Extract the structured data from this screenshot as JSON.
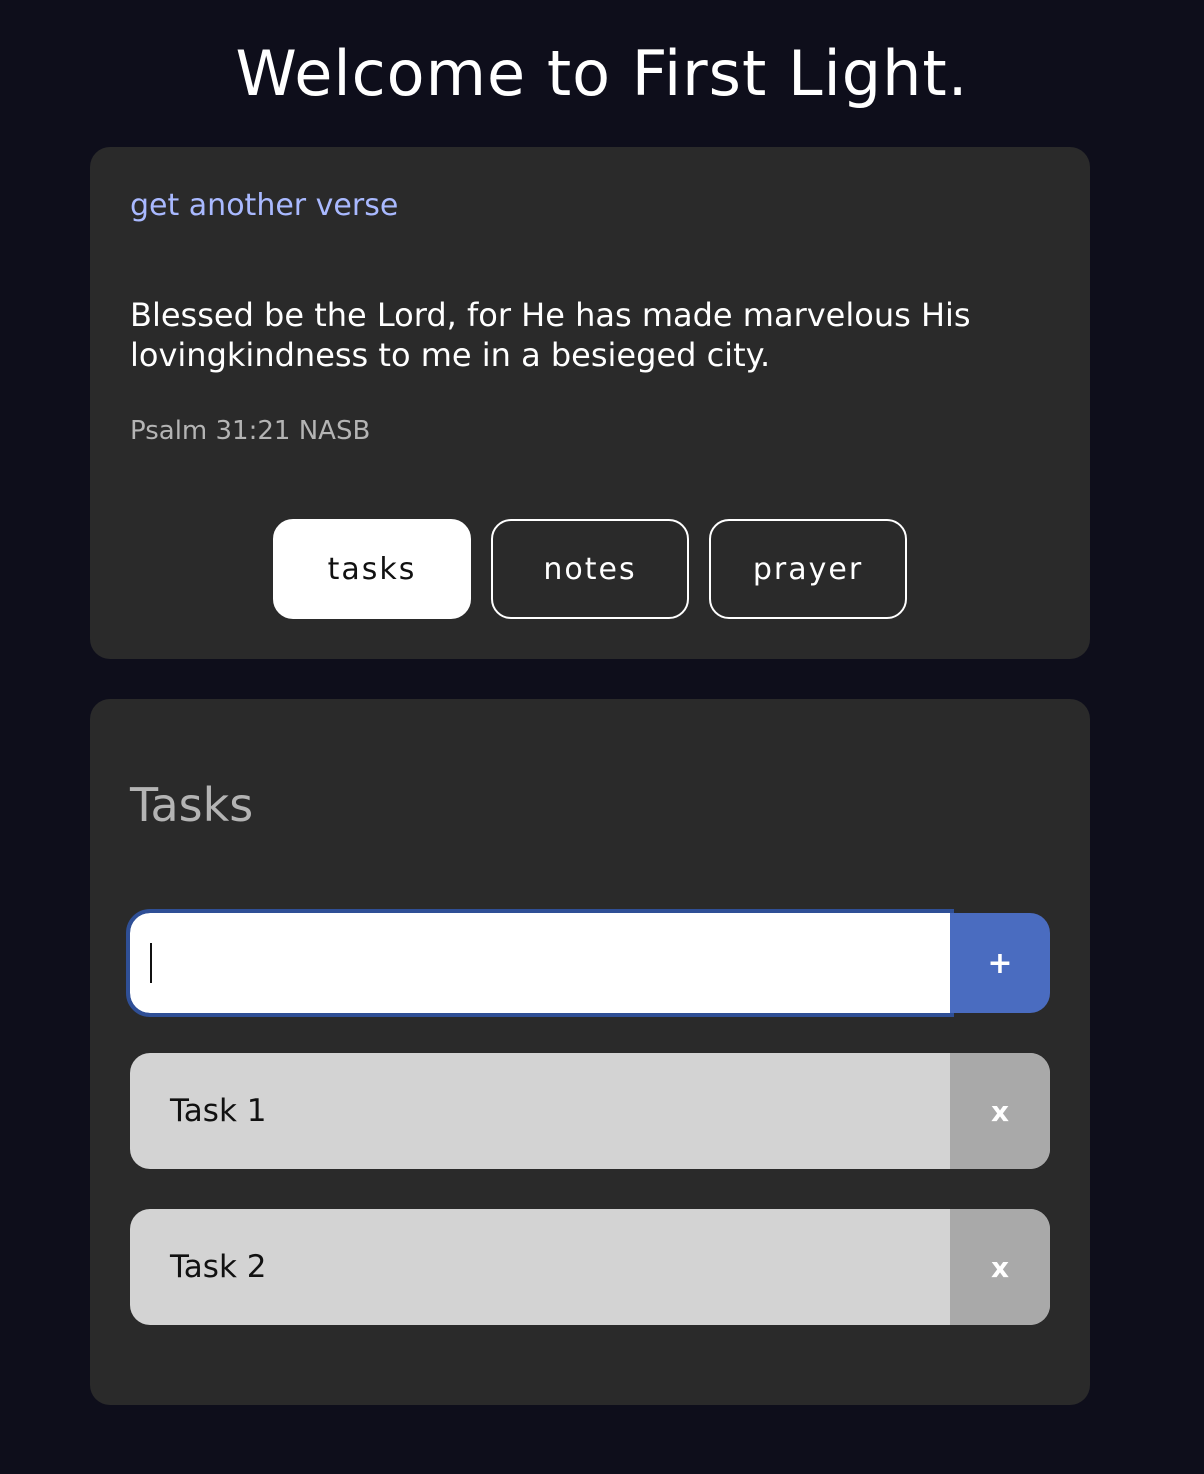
{
  "header": {
    "title": "Welcome to First Light."
  },
  "verse": {
    "new_verse_link": "get another verse",
    "text": "Blessed be the Lord, for He has made marvelous His lovingkindness to me in a besieged city.",
    "reference": "Psalm 31:21 NASB"
  },
  "tabs": [
    {
      "label": "tasks",
      "active": true
    },
    {
      "label": "notes",
      "active": false
    },
    {
      "label": "prayer",
      "active": false
    }
  ],
  "tasks": {
    "heading": "Tasks",
    "input_value": "",
    "add_label": "+",
    "items": [
      {
        "label": "Task 1",
        "remove_label": "x"
      },
      {
        "label": "Task 2",
        "remove_label": "x"
      }
    ]
  },
  "colors": {
    "background": "#0e0e1b",
    "card": "#2a2a2a",
    "link": "#a9b9ff",
    "accent": "#4a6cc0",
    "task_bg": "#d3d3d3",
    "remove_bg": "#a9a9a9"
  }
}
